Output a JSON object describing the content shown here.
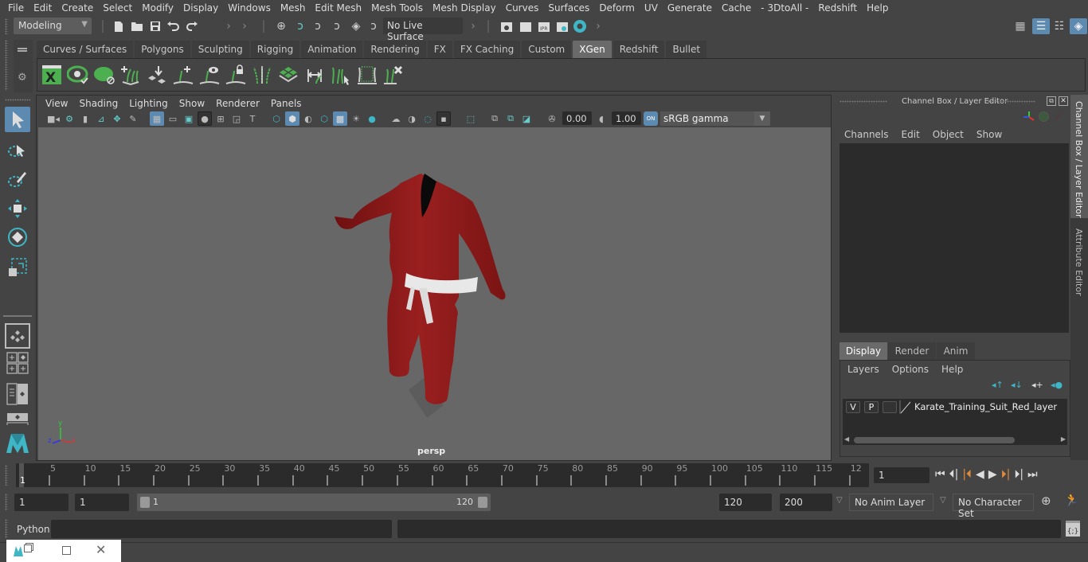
{
  "menubar": [
    "File",
    "Edit",
    "Create",
    "Select",
    "Modify",
    "Display",
    "Windows",
    "Mesh",
    "Edit Mesh",
    "Mesh Tools",
    "Mesh Display",
    "Curves",
    "Surfaces",
    "Deform",
    "UV",
    "Generate",
    "Cache",
    "- 3DtoAll -",
    "Redshift",
    "Help"
  ],
  "statusline": {
    "mode": "Modeling",
    "live_surface": "No Live Surface"
  },
  "shelf": {
    "tabs": [
      "Curves / Surfaces",
      "Polygons",
      "Sculpting",
      "Rigging",
      "Animation",
      "Rendering",
      "FX",
      "FX Caching",
      "Custom",
      "XGen",
      "Redshift",
      "Bullet"
    ],
    "active_tab": "XGen",
    "icons": [
      "xgen-editor-icon",
      "xgen-preview-icon",
      "xgen-clear-preview-icon",
      "xgen-add-guides-icon",
      "xgen-place-guides-icon",
      "xgen-add-guide-icon",
      "xgen-show-guides-icon",
      "xgen-lock-guides-icon",
      "xgen-split-guides-icon",
      "xgen-density-icon",
      "xgen-flip-icon",
      "xgen-select-guides-icon",
      "xgen-guide-cv-icon",
      "xgen-delete-guides-icon"
    ]
  },
  "viewport": {
    "menu": [
      "View",
      "Shading",
      "Lighting",
      "Show",
      "Renderer",
      "Panels"
    ],
    "exposure": "0.00",
    "gamma": "1.00",
    "color_mgmt": "ON",
    "colorspace": "sRGB gamma",
    "camera_label": "persp",
    "axis": {
      "x": "x",
      "y": "y",
      "z": "z"
    }
  },
  "channel_box": {
    "title": "Channel Box / Layer Editor",
    "menu": [
      "Channels",
      "Edit",
      "Object",
      "Show"
    ]
  },
  "layer_editor": {
    "tabs": [
      "Display",
      "Render",
      "Anim"
    ],
    "active_tab": "Display",
    "menu": [
      "Layers",
      "Options",
      "Help"
    ],
    "layers": [
      {
        "v": "V",
        "p": "P",
        "name": "Karate_Training_Suit_Red_layer"
      }
    ]
  },
  "side_tabs": [
    "Channel Box / Layer Editor",
    "Attribute Editor"
  ],
  "timeline": {
    "ticks": [
      "5",
      "10",
      "15",
      "20",
      "25",
      "30",
      "35",
      "40",
      "45",
      "50",
      "55",
      "60",
      "65",
      "70",
      "75",
      "80",
      "85",
      "90",
      "95",
      "100",
      "105",
      "110",
      "115",
      "12"
    ],
    "current_marker": "1",
    "current_frame": "1"
  },
  "range": {
    "start": "1",
    "anim_start": "1",
    "slider_start": "1",
    "slider_end": "120",
    "anim_end": "120",
    "end": "200",
    "anim_layer": "No Anim Layer",
    "character_set": "No Character Set"
  },
  "command_line": {
    "language": "Python"
  },
  "colors": {
    "accent": "#5d8ab0",
    "teal": "#3fb6c6",
    "shelf_green": "#4caf50",
    "suit_red": "#8b1a1a",
    "key_orange": "#e08a3c"
  }
}
